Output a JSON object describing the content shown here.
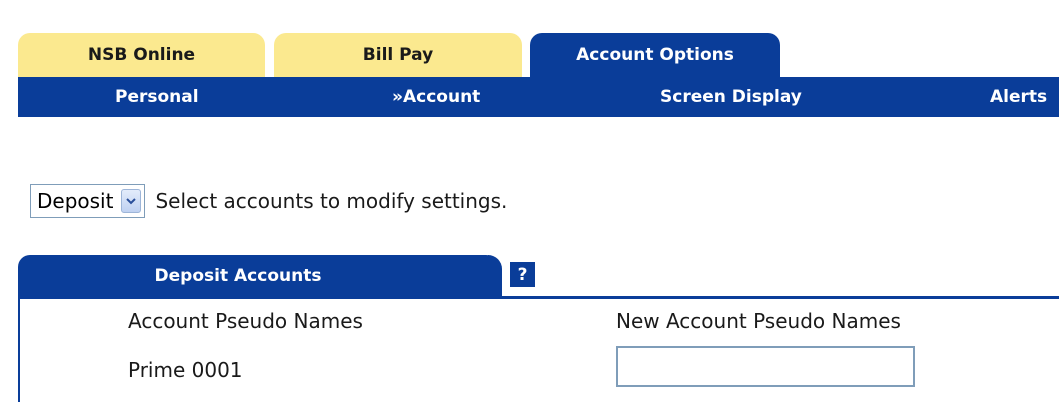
{
  "top_tabs": [
    {
      "label": "NSB Online",
      "active": false
    },
    {
      "label": "Bill Pay",
      "active": false
    },
    {
      "label": "Account Options",
      "active": true
    }
  ],
  "subnav": [
    {
      "label": "Personal"
    },
    {
      "label": "»Account"
    },
    {
      "label": "Screen Display"
    },
    {
      "label": "Alerts"
    }
  ],
  "selector": {
    "selected": "Deposit",
    "instruction": "Select accounts to modify settings."
  },
  "panel": {
    "title": "Deposit Accounts",
    "help_label": "?",
    "col_left": "Account Pseudo Names",
    "col_right": "New Account Pseudo Names",
    "rows": [
      {
        "name": "Prime 0001",
        "new_value": ""
      }
    ]
  },
  "colors": {
    "tab_inactive": "#fbe98f",
    "brand_blue": "#0a3d99"
  }
}
